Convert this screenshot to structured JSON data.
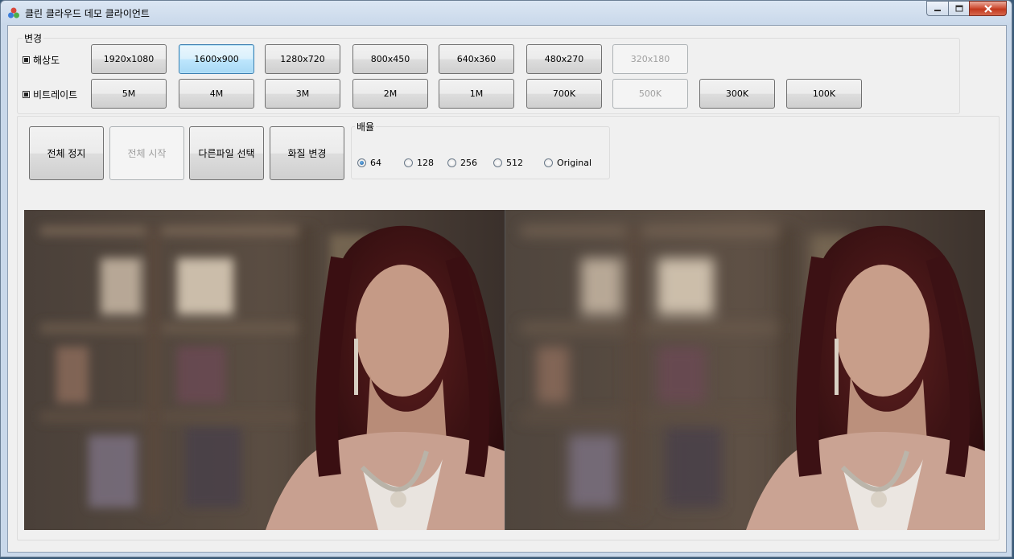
{
  "window": {
    "title": "클린 클라우드 데모 클라이언트",
    "icons": {
      "app": "app-icon",
      "minimize": "minimize-icon",
      "maximize": "maximize-icon",
      "close": "close-icon"
    }
  },
  "change_group": {
    "title": "변경",
    "resolution": {
      "label": "해상도",
      "options": [
        "1920x1080",
        "1600x900",
        "1280x720",
        "800x450",
        "640x360",
        "480x270",
        "320x180"
      ],
      "selected": "1600x900",
      "disabled": "320x180"
    },
    "bitrate": {
      "label": "비트레이트",
      "options": [
        "5M",
        "4M",
        "3M",
        "2M",
        "1M",
        "700K",
        "500K",
        "300K",
        "100K"
      ],
      "disabled": "500K"
    }
  },
  "controls": {
    "stop_all": "전체 정지",
    "start_all": "전체 시작",
    "select_file": "다른파일 선택",
    "change_quality": "화질 변경"
  },
  "ratio_group": {
    "title": "배율",
    "options": [
      "64",
      "128",
      "256",
      "512",
      "Original"
    ],
    "selected": "64"
  },
  "colors": {
    "accent": "#3c7fb1",
    "window_bg": "#f0f0f0",
    "close_button": "#c2391e"
  }
}
